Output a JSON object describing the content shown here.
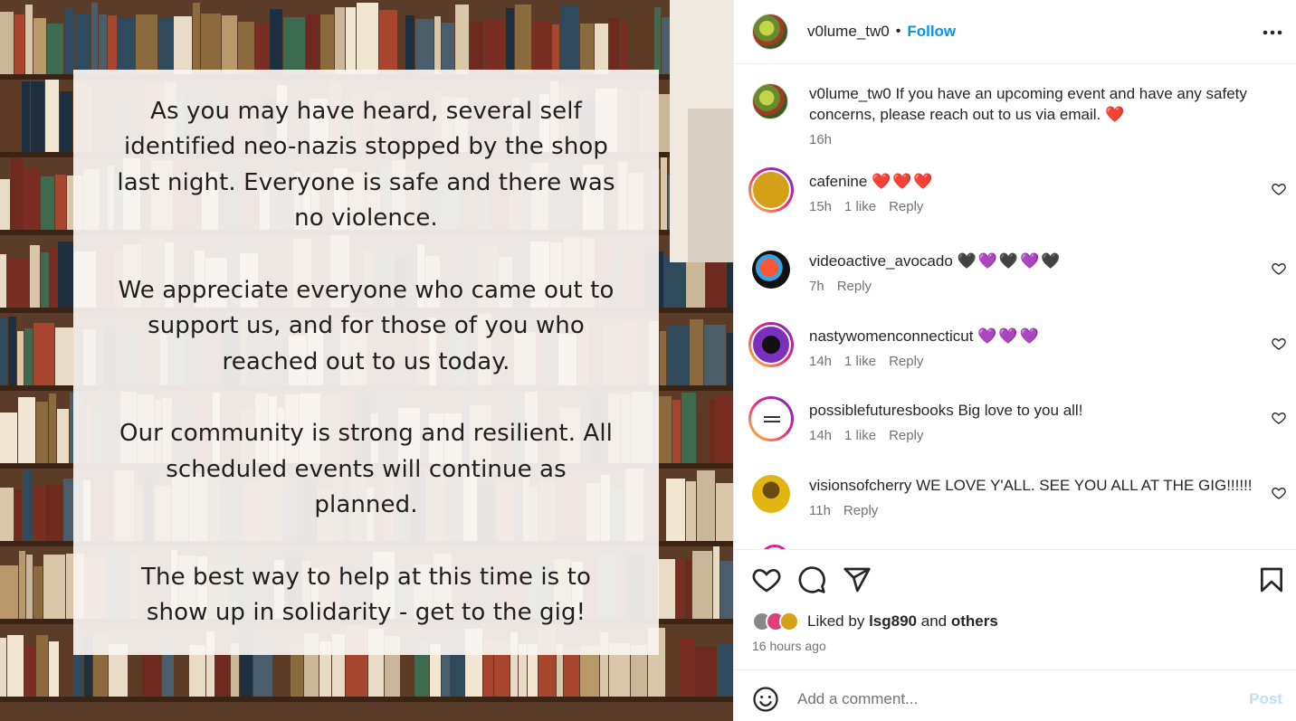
{
  "post": {
    "paragraphs": [
      "As you may have heard, several self\nidentified neo-nazis stopped by the shop\nlast night. Everyone is safe and there was\nno violence.",
      "We appreciate everyone who came out to\nsupport us, and for those of you who\nreached out to us today.",
      "Our community is strong and resilient. All\nscheduled events will continue as\nplanned.",
      "The best way to help at this time is to\nshow up in solidarity - get to the gig!"
    ]
  },
  "header": {
    "username": "v0lume_tw0",
    "separator": "•",
    "follow_label": "Follow",
    "more_label": "•••"
  },
  "caption": {
    "username": "v0lume_tw0",
    "text": "If you have an upcoming event and have any safety concerns, please reach out to us via email.",
    "emoji": "❤️",
    "time": "16h"
  },
  "comments": [
    {
      "username": "cafenine",
      "text": "",
      "emoji": "❤️❤️❤️",
      "time": "15h",
      "likes": "1 like",
      "reply": "Reply",
      "avatar_color": "#d4a017"
    },
    {
      "username": "videoactive_avocado",
      "text": "",
      "emoji": "🖤💜🖤💜🖤",
      "time": "7h",
      "likes": "",
      "reply": "Reply",
      "avatar_color": "#e0412b"
    },
    {
      "username": "nastywomenconnecticut",
      "text": "",
      "emoji": "💜💜💜",
      "time": "14h",
      "likes": "1 like",
      "reply": "Reply",
      "avatar_color": "#7b2fbf"
    },
    {
      "username": "possiblefuturesbooks",
      "text": "Big love to you all!",
      "emoji": "",
      "time": "14h",
      "likes": "1 like",
      "reply": "Reply",
      "avatar_color": "#ffffff"
    },
    {
      "username": "visionsofcherry",
      "text": "WE LOVE Y'ALL. SEE YOU ALL AT THE GIG!!!!!!",
      "emoji": "",
      "time": "11h",
      "likes": "",
      "reply": "Reply",
      "avatar_color": "#e3b512"
    }
  ],
  "likes": {
    "prefix": "Liked by",
    "user": "lsg890",
    "conj": "and",
    "others": "others",
    "time_ago": "16 hours ago"
  },
  "add_comment": {
    "placeholder": "Add a comment...",
    "post_label": "Post"
  },
  "colors": {
    "accent": "#0095f6",
    "post_disabled": "#c0dffd",
    "story_ring": "#d6249f"
  }
}
